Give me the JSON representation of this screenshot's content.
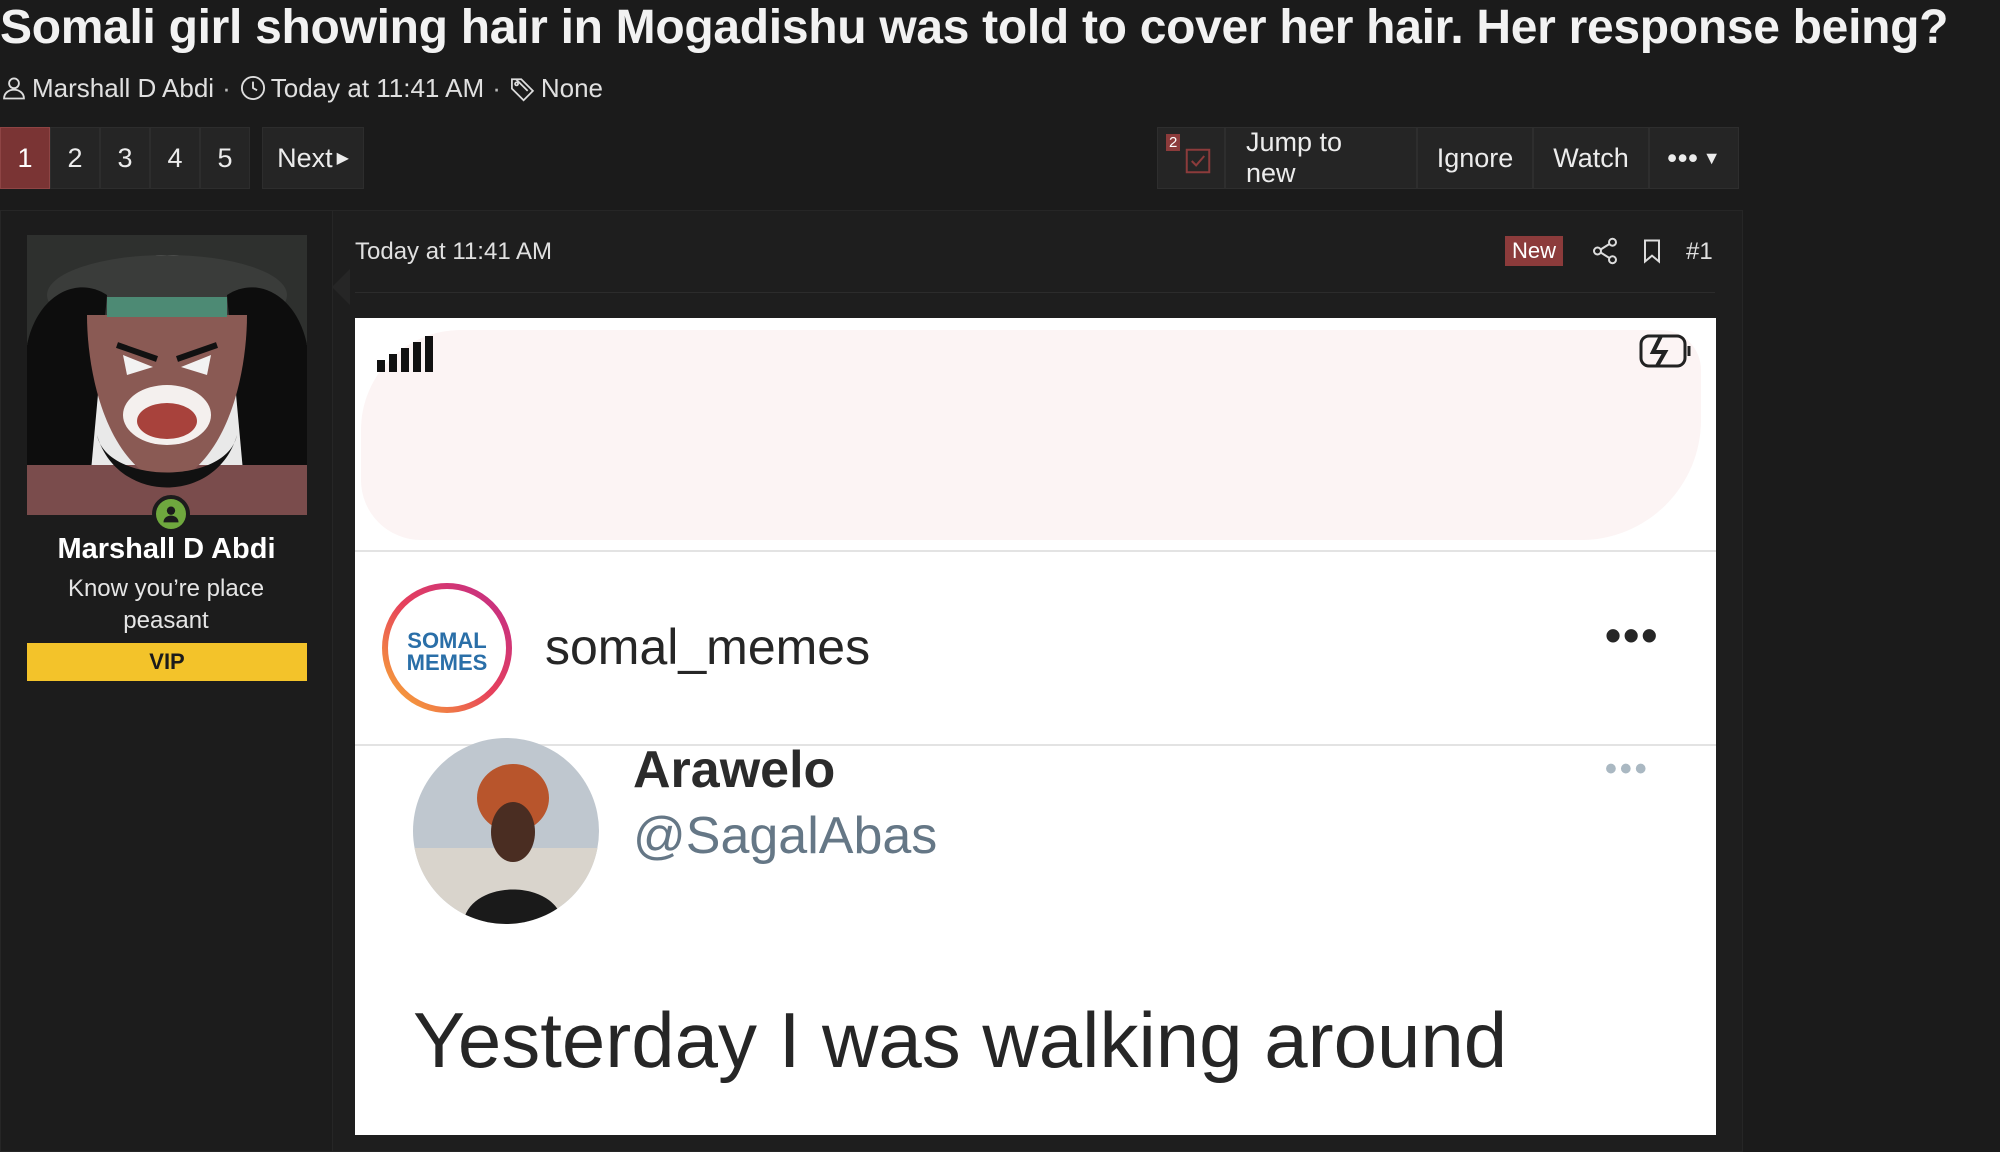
{
  "thread": {
    "title": "Somali girl showing hair in Mogadishu was told to cover her hair. Her response being?",
    "author": "Marshall D Abdi",
    "date": "Today at 11:41 AM",
    "tags": "None",
    "sep": "·"
  },
  "pagination": {
    "pages": [
      "1",
      "2",
      "3",
      "4",
      "5"
    ],
    "next": "Next"
  },
  "actions": {
    "unread_count": "2",
    "jump": "Jump to new",
    "ignore": "Ignore",
    "watch": "Watch",
    "more": "•••"
  },
  "post": {
    "user": {
      "name": "Marshall D Abdi",
      "title": "Know you’re place peasant",
      "banner": "VIP"
    },
    "date": "Today at 11:41 AM",
    "new_badge": "New",
    "number": "#1",
    "screenshot": {
      "ig_username": "somal_memes",
      "ig_logo_text": "SOMAL MEMES",
      "ig_menu": "•••",
      "tweet_name": "Arawelo",
      "tweet_handle": "@SagalAbas",
      "tweet_menu": "•••",
      "tweet_text": "Yesterday I was walking around"
    }
  },
  "colors": {
    "background": "#1b1b1b",
    "active_page": "#7a3434",
    "vip_banner": "#f3c32a",
    "online": "#6fa83e"
  },
  "icons": [
    "user-icon",
    "clock-icon",
    "tag-icon",
    "checkbox-icon",
    "share-icon",
    "bookmark-icon",
    "online-status-icon",
    "caret-down-icon"
  ]
}
